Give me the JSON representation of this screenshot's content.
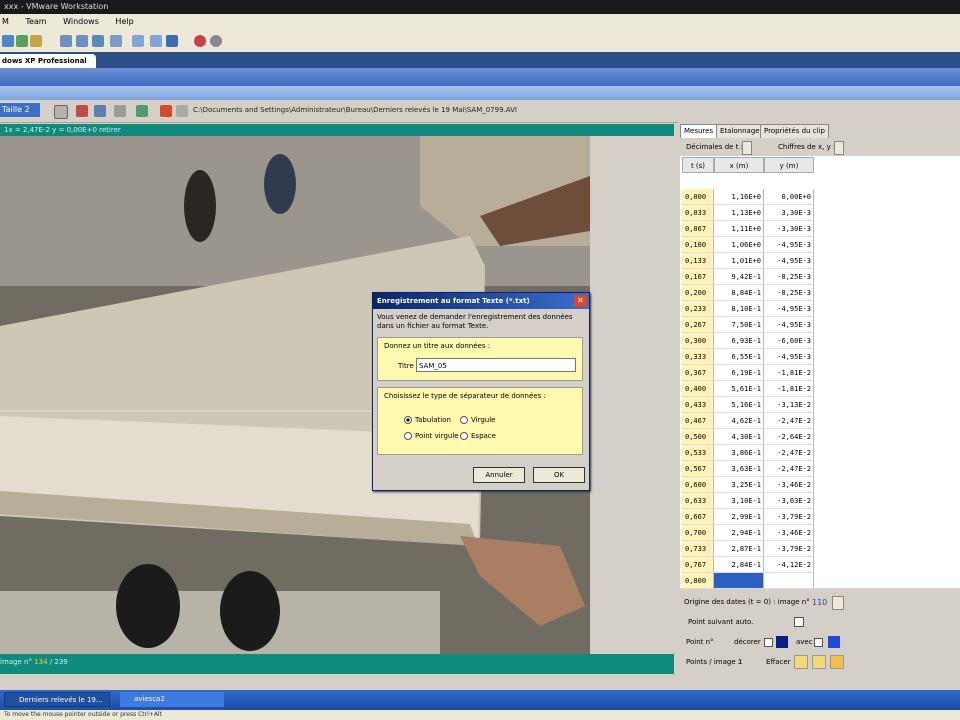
{
  "vmware": {
    "title": "xxx - VMware Workstation",
    "menu": [
      "M",
      "Team",
      "Windows",
      "Help"
    ],
    "vm_tab": "dows XP Professional"
  },
  "app": {
    "reel_button": "Taille 2",
    "file_path": "C:\\Documents and Settings\\Administrateur\\Bureau\\Derniers relevés le 19 Mai\\SAM_0799.AVI",
    "video_header": "1x = 2,47E-2   y = 0,00E+0   retirer",
    "status_image_label": "image n°",
    "status_image_current": "134",
    "status_image_total": "/ 239"
  },
  "panel": {
    "tabs": [
      "Mesures",
      "Etalonnage",
      "Propriétés du clip"
    ],
    "decimales_label": "Décimales de t :",
    "chiffres_label": "Chiffres de x, y :",
    "columns": [
      "t (s)",
      "x (m)",
      "y (m)"
    ],
    "rows": [
      [
        "0,000",
        "1,16E+0",
        "0,00E+0"
      ],
      [
        "0,033",
        "1,13E+0",
        "3,30E-3"
      ],
      [
        "0,067",
        "1,11E+0",
        "-3,30E-3"
      ],
      [
        "0,100",
        "1,06E+0",
        "-4,95E-3"
      ],
      [
        "0,133",
        "1,01E+0",
        "-4,95E-3"
      ],
      [
        "0,167",
        "9,42E-1",
        "-8,25E-3"
      ],
      [
        "0,200",
        "8,84E-1",
        "-8,25E-3"
      ],
      [
        "0,233",
        "8,10E-1",
        "-4,95E-3"
      ],
      [
        "0,267",
        "7,50E-1",
        "-4,95E-3"
      ],
      [
        "0,300",
        "6,93E-1",
        "-6,60E-3"
      ],
      [
        "0,333",
        "6,55E-1",
        "-4,95E-3"
      ],
      [
        "0,367",
        "6,19E-1",
        "-1,81E-2"
      ],
      [
        "0,400",
        "5,61E-1",
        "-1,81E-2"
      ],
      [
        "0,433",
        "5,16E-1",
        "-3,13E-2"
      ],
      [
        "0,467",
        "4,62E-1",
        "-2,47E-2"
      ],
      [
        "0,500",
        "4,30E-1",
        "-2,64E-2"
      ],
      [
        "0,533",
        "3,86E-1",
        "-2,47E-2"
      ],
      [
        "0,567",
        "3,63E-1",
        "-2,47E-2"
      ],
      [
        "0,600",
        "3,25E-1",
        "-3,46E-2"
      ],
      [
        "0,633",
        "3,10E-1",
        "-3,63E-2"
      ],
      [
        "0,667",
        "2,99E-1",
        "-3,79E-2"
      ],
      [
        "0,700",
        "2,94E-1",
        "-3,46E-2"
      ],
      [
        "0,733",
        "2,87E-1",
        "-3,79E-2"
      ],
      [
        "0,767",
        "2,84E-1",
        "-4,12E-2"
      ],
      [
        "0,800",
        "",
        ""
      ]
    ],
    "origin_label": "Origine des dates (t = 0) : image n°",
    "origin_value": "110",
    "point_suivant": "Point suivant auto.",
    "point_label": "Point n°",
    "decorer_label": "décorer",
    "suivi_label": "avec",
    "points_image_label": "Points / image :",
    "points_image_value": "1",
    "effacer_label": "Effacer"
  },
  "dialog": {
    "title": "Enregistrement au format Texte (*.txt)",
    "message": "Vous venez de demander l'enregistrement des données dans un fichier au format Texte.",
    "group1_title": "Donnez un titre aux données :",
    "titre_label": "Titre",
    "titre_value": "SAM_05",
    "group2_title": "Choisissez le type de séparateur de données :",
    "options": [
      "Tabulation",
      "Virgule",
      "Point virgule",
      "Espace"
    ],
    "cancel": "Annuler",
    "ok": "OK"
  },
  "taskbar": {
    "items": [
      "Derniers relevés le 19...",
      "aviesca2"
    ]
  },
  "vm_status": "To move the mouse pointer outside or press Ctrl+Alt"
}
